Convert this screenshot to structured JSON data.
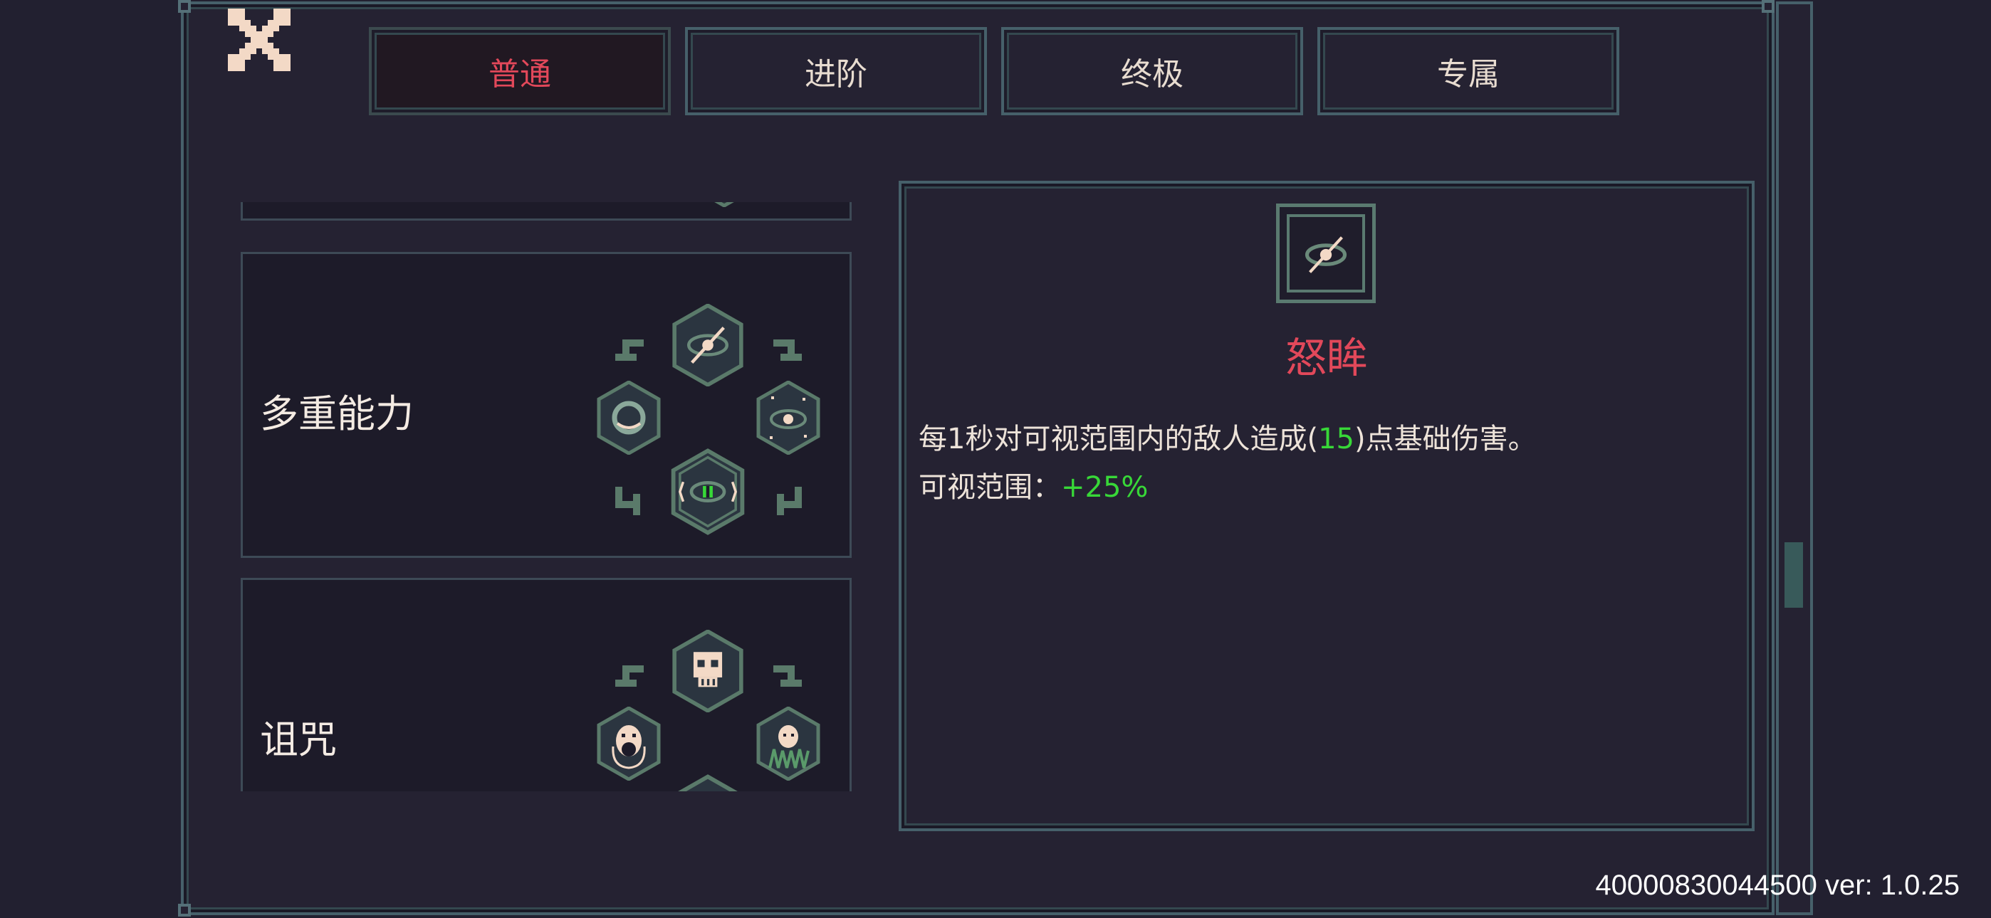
{
  "tabs": [
    {
      "label": "普通",
      "active": true
    },
    {
      "label": "进阶",
      "active": false
    },
    {
      "label": "终极",
      "active": false
    },
    {
      "label": "专属",
      "active": false
    }
  ],
  "ability_list": [
    {
      "title": "多重能力",
      "icons": [
        "eye-slash-icon",
        "eye-ring-icon",
        "eye-sparkle-icon",
        "eye-pulse-icon"
      ]
    },
    {
      "title": "诅咒",
      "icons": [
        "skull-icon",
        "screaming-head-icon",
        "ghost-icon",
        "skull-icon"
      ]
    }
  ],
  "detail": {
    "icon": "eye-slash-icon",
    "name": "怒眸",
    "desc_line1_pre": "每",
    "desc_line1_num1": "1",
    "desc_line1_mid": "秒对可视范围内的敌人造成(",
    "desc_line1_num2": "15",
    "desc_line1_post": ")点基础伤害。",
    "desc_line2_label": "可视范围：",
    "desc_line2_value": "+25%"
  },
  "version_text": "40000830044500 ver: 1.0.25",
  "colors": {
    "accent_red": "#e2485a",
    "value_green": "#38d838",
    "frame": "#46606a"
  }
}
